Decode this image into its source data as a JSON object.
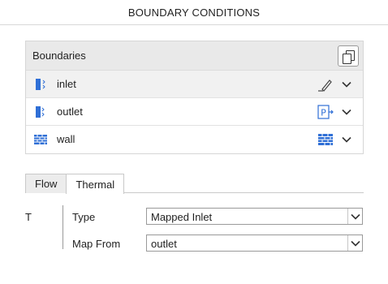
{
  "title": "BOUNDARY CONDITIONS",
  "boundaries": {
    "header": "Boundaries",
    "items": [
      {
        "label": "inlet",
        "selected": true,
        "type_icon": "inlet-boundary-icon",
        "right_icon": "pencil-edit-icon"
      },
      {
        "label": "outlet",
        "selected": false,
        "type_icon": "outlet-boundary-icon",
        "right_icon": "pressure-outlet-icon"
      },
      {
        "label": "wall",
        "selected": false,
        "type_icon": "wall-boundary-icon",
        "right_icon": "wall-icon"
      }
    ]
  },
  "tabs": [
    {
      "label": "Flow",
      "active": false
    },
    {
      "label": "Thermal",
      "active": true
    }
  ],
  "section_label": "T",
  "fields": [
    {
      "label": "Type",
      "value": "Mapped Inlet"
    },
    {
      "label": "Map From",
      "value": "outlet"
    }
  ],
  "colors": {
    "accent_blue": "#2f6fd6",
    "header_bg": "#e9e9e9",
    "selected_row_bg": "#f1f1f1"
  }
}
